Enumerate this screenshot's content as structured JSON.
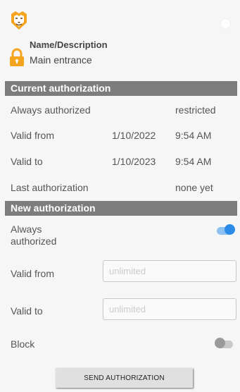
{
  "header": {
    "name_label": "Name/Description",
    "name_value": "Main entrance"
  },
  "current_authorization": {
    "title": "Current authorization",
    "always_authorized_label": "Always authorized",
    "always_authorized_value": "restricted",
    "valid_from_label": "Valid from",
    "valid_from_date": "1/10/2022",
    "valid_from_time": "9:54 AM",
    "valid_to_label": "Valid to",
    "valid_to_date": "1/10/2023",
    "valid_to_time": "9:54 AM",
    "last_authorization_label": "Last authorization",
    "last_authorization_value": "none yet"
  },
  "new_authorization": {
    "title": "New authorization",
    "always_authorized_label_line1": "Always",
    "always_authorized_label_line2": "authorized",
    "always_authorized_on": true,
    "valid_from_label": "Valid from",
    "valid_from_placeholder": "unlimited",
    "valid_to_label": "Valid to",
    "valid_to_placeholder": "unlimited",
    "block_label": "Block",
    "block_on": false
  },
  "actions": {
    "send_label": "SEND AUTHORIZATION"
  },
  "colors": {
    "accent": "#2b8be6",
    "lock": "#f4a41e",
    "section_header": "#7d7d7d"
  },
  "icons": [
    "lion-logo-icon",
    "lock-icon"
  ]
}
